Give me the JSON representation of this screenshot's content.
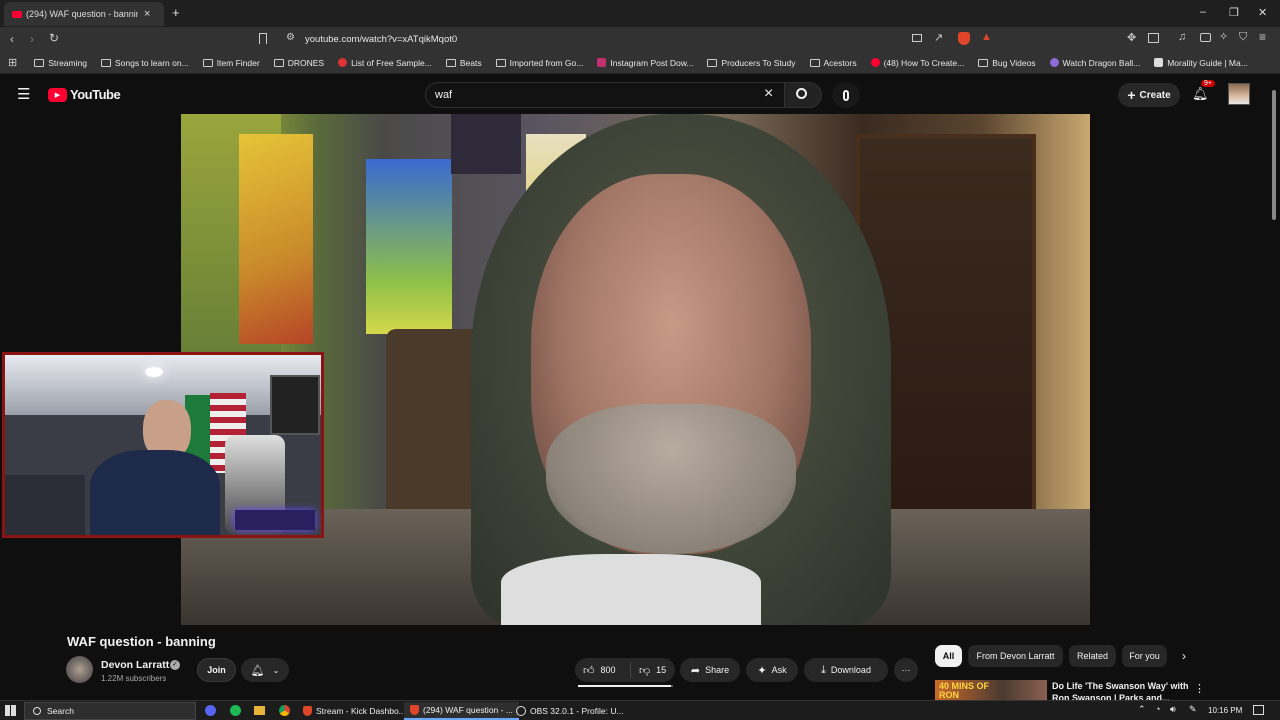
{
  "browser": {
    "tabs": [
      {
        "label": "(294) WAF question - banning",
        "active": true
      }
    ],
    "url": "youtube.com/watch?v=xATqikMqot0",
    "bookmarks": [
      {
        "label": "Streaming",
        "icon": "folder"
      },
      {
        "label": "Songs to learn on...",
        "icon": "folder"
      },
      {
        "label": "Item Finder",
        "icon": "folder"
      },
      {
        "label": "DRONES",
        "icon": "folder"
      },
      {
        "label": "List of Free Sample...",
        "icon": "site"
      },
      {
        "label": "Beats",
        "icon": "folder"
      },
      {
        "label": "Imported from Go...",
        "icon": "folder"
      },
      {
        "label": "Instagram Post Dow...",
        "icon": "site"
      },
      {
        "label": "Producers To Study",
        "icon": "folder"
      },
      {
        "label": "Acestors",
        "icon": "folder"
      },
      {
        "label": "(48) How To Create...",
        "icon": "site"
      },
      {
        "label": "Bug Videos",
        "icon": "folder"
      },
      {
        "label": "Watch Dragon Ball...",
        "icon": "site"
      },
      {
        "label": "Morality Guide | Ma...",
        "icon": "site"
      }
    ]
  },
  "youtube": {
    "logo": "YouTube",
    "search": {
      "value": "waf"
    },
    "create_label": "Create",
    "notifications_badge": "9+",
    "video": {
      "title": "WAF question - banning",
      "channel": "Devon Larratt",
      "subscribers": "1.22M subscribers",
      "join_label": "Join",
      "likes": "800",
      "dislikes": "15",
      "share_label": "Share",
      "ask_label": "Ask",
      "download_label": "Download"
    },
    "chips": [
      "All",
      "From Devon Larratt",
      "Related",
      "For you"
    ],
    "recommendation": {
      "thumb_text": "40 MINS OF RON",
      "title_line1": "Do Life 'The Swanson Way' with",
      "title_line2": "Ron Swanson | Parks and..."
    }
  },
  "taskbar": {
    "search_label": "Search",
    "items": [
      {
        "label": "Stream - Kick Dashbo...",
        "active": false
      },
      {
        "label": "(294) WAF question - ...",
        "active": true
      },
      {
        "label": "OBS 32.0.1 - Profile: U...",
        "active": false
      }
    ],
    "time": "10:16 PM"
  },
  "colors": {
    "yt_red": "#ff0033",
    "webcam_border": "#8a1414",
    "background": "#0f0f0f"
  }
}
